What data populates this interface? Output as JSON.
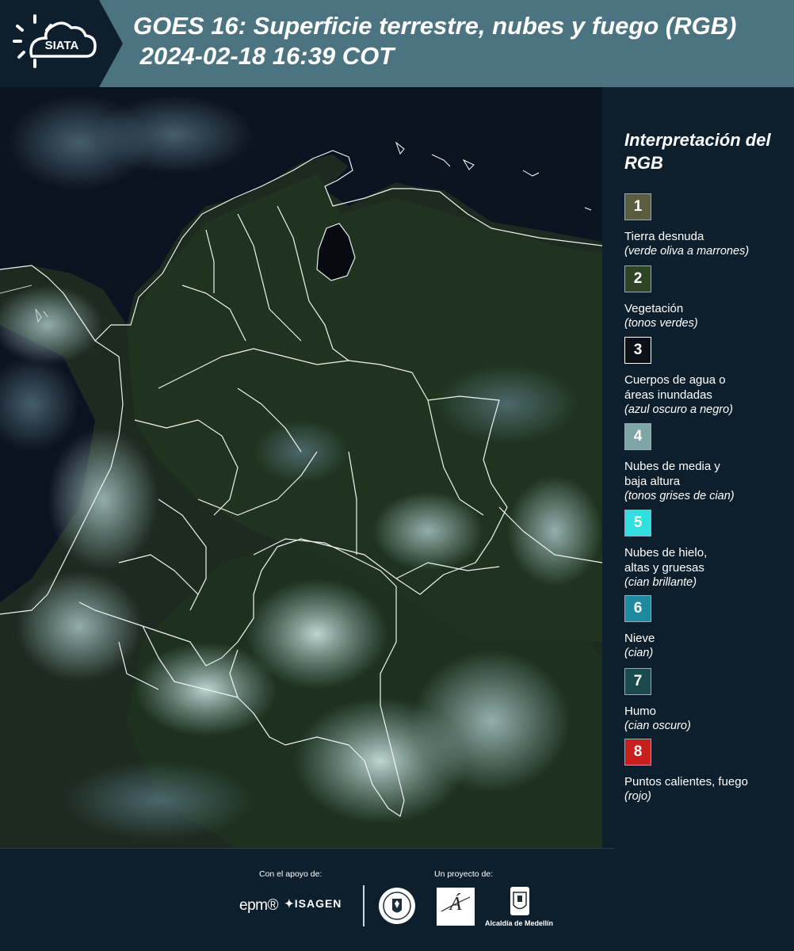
{
  "header": {
    "logo_text": "SIATA",
    "title_line1": "GOES 16: Superficie terrestre, nubes y fuego (RGB)",
    "title_line2": " 2024-02-18 16:39 COT"
  },
  "legend": {
    "title": "Interpretación del RGB",
    "items": [
      {
        "num": "1",
        "label": "Tierra desnuda",
        "sub": "(verde oliva a marrones)",
        "color": "#5c5c3e"
      },
      {
        "num": "2",
        "label": "Vegetación",
        "sub": "(tonos verdes)",
        "color": "#2e4424"
      },
      {
        "num": "3",
        "label": "Cuerpos de agua o áreas inundadas",
        "sub": "(azul oscuro a negro)",
        "color": "#0a0f18"
      },
      {
        "num": "4",
        "label": "Nubes de media y baja altura",
        "sub": "(tonos grises de cian)",
        "color": "#7fa6a6"
      },
      {
        "num": "5",
        "label": "Nubes de hielo, altas y gruesas",
        "sub": "(cian brillante)",
        "color": "#30e0e0"
      },
      {
        "num": "6",
        "label": "Nieve",
        "sub": "(cian)",
        "color": "#1e8aa0"
      },
      {
        "num": "7",
        "label": "Humo",
        "sub": "(cian oscuro)",
        "color": "#1a4a4c"
      },
      {
        "num": "8",
        "label": "Puntos calientes, fuego",
        "sub": "(rojo)",
        "color": "#c81e1e"
      }
    ]
  },
  "footer": {
    "support_label": "Con el apoyo de:",
    "project_label": "Un proyecto de:",
    "epm": "epm®",
    "isagen": "ISAGEN",
    "alcaldia": "Alcaldía de Medellín"
  }
}
